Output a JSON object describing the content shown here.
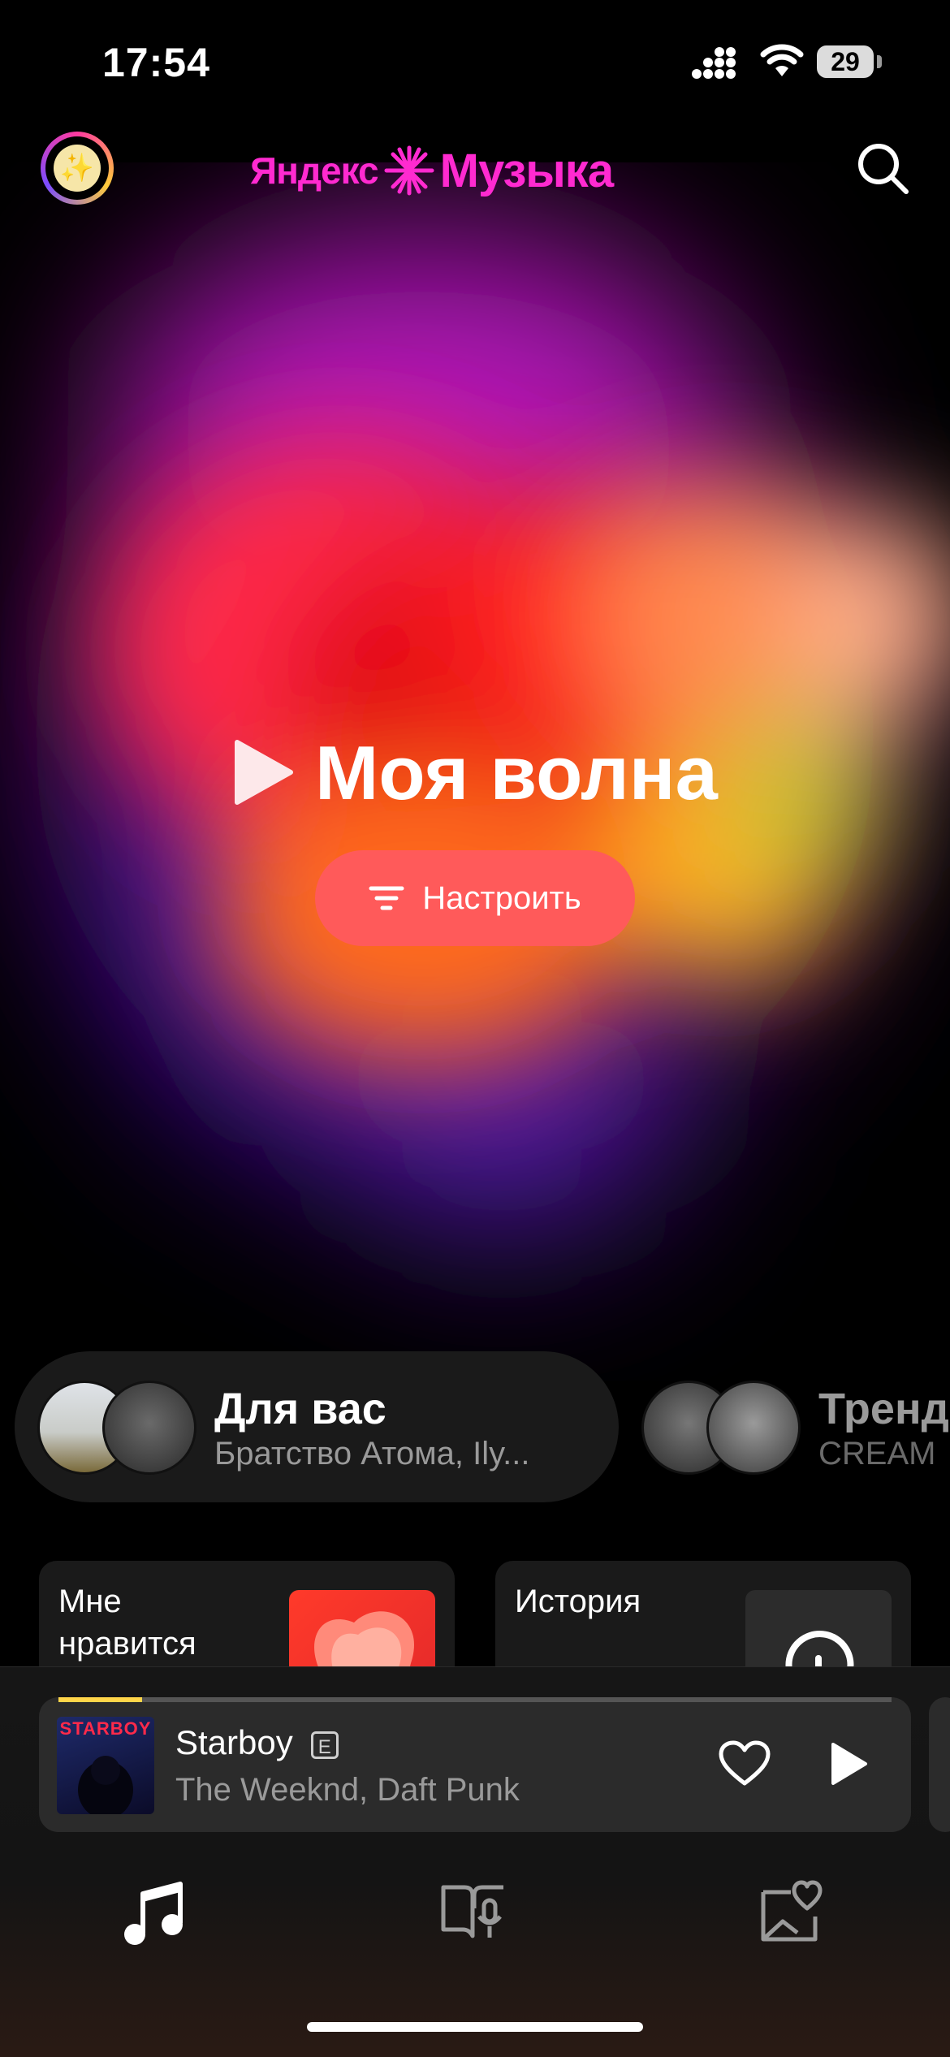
{
  "status_bar": {
    "time": "17:54",
    "battery": "29"
  },
  "header": {
    "logo_part1": "Яндекс",
    "logo_part2": "Музыка"
  },
  "hero": {
    "title": "Моя волна",
    "tune_label": "Настроить"
  },
  "chips": [
    {
      "title": "Для вас",
      "subtitle": "Братство Атома, Ily..."
    },
    {
      "title": "Тренд",
      "subtitle": "CREAM"
    }
  ],
  "tiles": [
    {
      "label": "Мне\nнравится"
    },
    {
      "label": "История"
    }
  ],
  "player": {
    "song": "Starboy",
    "explicit_badge": "E",
    "artist": "The Weeknd, Daft Punk",
    "progress": 0.1,
    "cover_text": "STARBOY"
  },
  "icons": {
    "avatar": "sparkle-icon",
    "search": "search-icon",
    "play": "play-icon",
    "tune": "filter-icon",
    "like": "heart-icon",
    "tabs": [
      "music-note-icon",
      "podcast-book-icon",
      "collection-heart-icon"
    ]
  },
  "colors": {
    "brand": "#ff2ad0",
    "tune_button": "#ff5a5a",
    "progress": "#ffd64a"
  }
}
